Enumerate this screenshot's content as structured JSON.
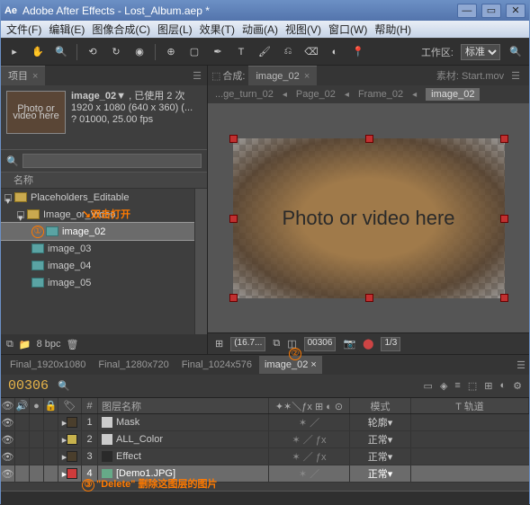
{
  "window": {
    "title": "Adobe After Effects - Lost_Album.aep *"
  },
  "menu": [
    "文件(F)",
    "编辑(E)",
    "图像合成(C)",
    "图层(L)",
    "效果(T)",
    "动画(A)",
    "视图(V)",
    "窗口(W)",
    "帮助(H)"
  ],
  "workspace": {
    "label": "工作区:",
    "value": "标准"
  },
  "project": {
    "tab": "项目",
    "selected": {
      "name": "image_02▼",
      "used": "已使用 2 次",
      "dims": "1920 x 1080  (640 x 360) (...",
      "rate": "? 01000, 25.00 fps",
      "thumb": "Photo or video here"
    },
    "search_placeholder": "",
    "col": "名称",
    "tree": [
      {
        "type": "folder",
        "name": "Placeholders_Editable",
        "indent": 0
      },
      {
        "type": "folder",
        "name": "Image_or_Video",
        "indent": 1
      },
      {
        "type": "comp",
        "name": "image_02",
        "indent": 2,
        "sel": true,
        "marker": "①"
      },
      {
        "type": "comp",
        "name": "image_03",
        "indent": 2
      },
      {
        "type": "comp",
        "name": "image_04",
        "indent": 2
      },
      {
        "type": "comp",
        "name": "image_05",
        "indent": 2
      }
    ],
    "footer": {
      "bpc": "8 bpc"
    },
    "anno1": "双击打开"
  },
  "comp": {
    "label": "合成:",
    "name": "image_02",
    "material_label": "素材:",
    "material": "Start.mov",
    "breadcrumbs": [
      "...ge_turn_02",
      "Page_02",
      "Frame_02",
      "image_02"
    ],
    "placeholder": "Photo or video\nhere",
    "footer": {
      "zoom": "(16.7...",
      "time": "00306",
      "ratio": "1/3"
    }
  },
  "timeline": {
    "tabs": [
      "Final_1920x1080",
      "Final_1280x720",
      "Final_1024x576",
      "image_02"
    ],
    "active": 3,
    "marker": "②",
    "time": "00306",
    "hdr": {
      "layer_name": "图层名称",
      "mode": "模式",
      "track": "T 轨道"
    },
    "layers": [
      {
        "num": 1,
        "color": "#4a3e2c",
        "name": "Mask",
        "mode": "轮廓"
      },
      {
        "num": 2,
        "color": "#c7b24d",
        "name": "ALL_Color",
        "mode": "正常"
      },
      {
        "num": 3,
        "color": "#4a3e2c",
        "name": "Effect",
        "mode": "正常"
      },
      {
        "num": 4,
        "color": "#cf3b3b",
        "name": "[Demo1.JPG]",
        "mode": "正常",
        "sel": true
      }
    ],
    "anno3": "\"Delete\" 删除这图层的图片",
    "marker3": "③"
  }
}
